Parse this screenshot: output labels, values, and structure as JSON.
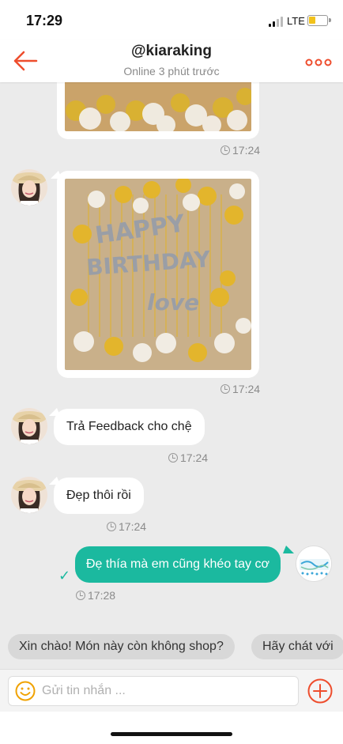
{
  "status_bar": {
    "time": "17:29",
    "network": "LTE",
    "battery_color": "#f2c21b"
  },
  "header": {
    "title": "@kiaraking",
    "subtitle": "Online 3 phút trước",
    "accent": "#ee4d2d"
  },
  "messages": [
    {
      "type": "image",
      "from": "other",
      "content": "gold and white balloons",
      "time": "17:24"
    },
    {
      "type": "image",
      "from": "other",
      "content": "HAPPY BIRTHDAY love balloon wall with gold tinsel curtain",
      "time": "17:24"
    },
    {
      "type": "text",
      "from": "other",
      "text": "Trả Feedback cho chệ",
      "time": "17:24"
    },
    {
      "type": "text",
      "from": "other",
      "text": "Đẹp thôi rồi",
      "time": "17:24"
    },
    {
      "type": "text",
      "from": "me",
      "text": "Đẹ thía mà em cũng khéo tay cơ",
      "time": "17:28",
      "status": "sent"
    }
  ],
  "quick_replies": [
    "Xin chào! Món này còn không shop?",
    "Hãy chát với"
  ],
  "input": {
    "placeholder": "Gửi tin nhắn ..."
  },
  "colors": {
    "my_bubble": "#1bb99f",
    "chat_bg": "#ebebeb",
    "accent": "#ee4d2d",
    "emoji": "#f0a202"
  },
  "icons": [
    "back-arrow-icon",
    "more-dots-icon",
    "clock-icon",
    "check-icon",
    "emoji-icon",
    "plus-icon"
  ]
}
